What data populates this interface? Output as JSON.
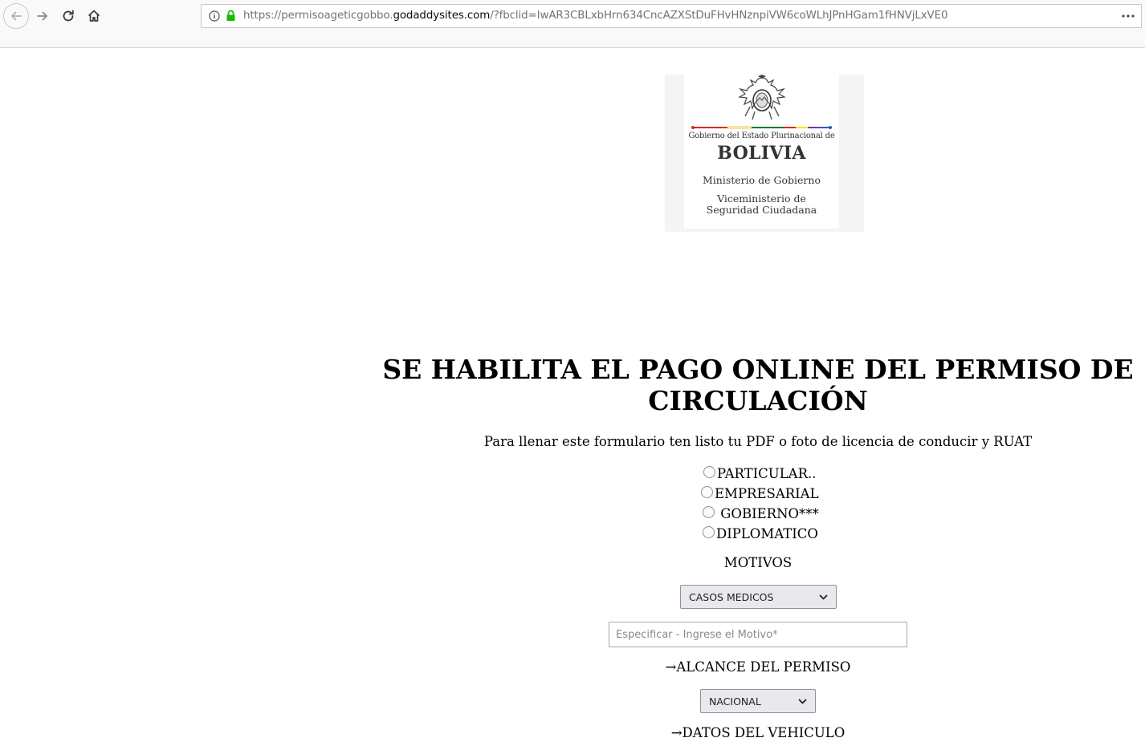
{
  "browser": {
    "url_prefix": "https://permisoageticgobbo.",
    "url_domain": "godaddysites.com",
    "url_suffix": "/?fbclid=IwAR3CBLxbHrn634CncAZXStDuFHvHNznpiVW6coWLhJPnHGam1fHNVjLxVE0",
    "icons": [
      "back-arrow-icon",
      "forward-arrow-icon",
      "reload-icon",
      "home-icon",
      "info-icon",
      "lock-icon",
      "more-icon"
    ]
  },
  "logo": {
    "government_line": "Gobierno del Estado Plurinacional de",
    "country": "BOLIVIA",
    "ministry": "Ministerio de Gobierno",
    "vice_ministry_1": "Viceministerio de",
    "vice_ministry_2": "Seguridad Ciudadana",
    "flag_colors": [
      "#d52b1e",
      "#f9e300",
      "#007934"
    ]
  },
  "page": {
    "headline_line1": "SE HABILITA EL PAGO ONLINE DEL PERMISO DE",
    "headline_line2": "CIRCULACIÓN",
    "subtitle": "Para llenar este formulario ten listo tu PDF o foto de licencia de conducir y RUAT",
    "vehicle_types": [
      {
        "label": "PARTICULAR.."
      },
      {
        "label": "EMPRESARIAL"
      },
      {
        "label": " GOBIERNO***"
      },
      {
        "label": "DIPLOMATICO"
      }
    ],
    "motivos_label": "MOTIVOS",
    "motivo_selected": "CASOS MEDICOS",
    "motivo_placeholder": "Especificar - Ingrese el Motivo*",
    "alcance_label": "→ALCANCE DEL PERMISO",
    "alcance_selected": "NACIONAL",
    "vehiculo_label": "→DATOS DEL VEHICULO"
  }
}
